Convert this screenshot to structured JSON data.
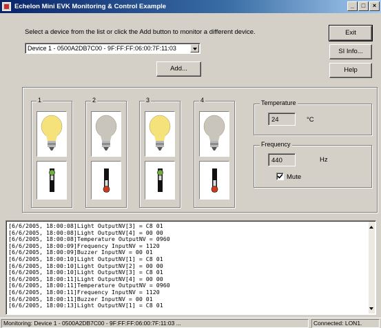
{
  "window": {
    "title": "Echelon Mini EVK Monitoring & Control Example",
    "controls": {
      "minimize": "_",
      "maximize": "□",
      "close": "×"
    }
  },
  "instructions": "Select a device from the list or click the Add button to monitor a different device.",
  "device_select": {
    "selected": "Device 1 - 0500A2DB7C00 - 9F:FF:FF:06:00:7F:11:03"
  },
  "buttons": {
    "exit": "Exit",
    "si_info": "SI Info...",
    "help": "Help",
    "add": "Add..."
  },
  "devices": [
    {
      "number": "1",
      "bulb": "bulb-on-icon",
      "switch": "switch-up-icon",
      "bulb_on": true
    },
    {
      "number": "2",
      "bulb": "bulb-off-icon",
      "switch": "switch-down-icon",
      "bulb_on": false
    },
    {
      "number": "3",
      "bulb": "bulb-on-icon",
      "switch": "switch-up-icon",
      "bulb_on": true
    },
    {
      "number": "4",
      "bulb": "bulb-off-icon",
      "switch": "switch-down-icon",
      "bulb_on": false
    }
  ],
  "temperature": {
    "label": "Temperature",
    "value": "24",
    "unit": "°C"
  },
  "frequency": {
    "label": "Frequency",
    "value": "440",
    "unit": "Hz"
  },
  "mute": {
    "label": "Mute",
    "checked": true
  },
  "log": [
    "[6/6/2005, 18:00:08]Light OutputNV[3] = C8 01",
    "[6/6/2005, 18:00:08]Light OutputNV[4] = 00 00",
    "[6/6/2005, 18:00:08]Temperature OutputNV = 0960",
    "[6/6/2005, 18:00:09]Frequency InputNV = 1120",
    "[6/6/2005, 18:00:09]Buzzer InputNV = 00 01",
    "[6/6/2005, 18:00:10]Light OutputNV[1] = C8 01",
    "[6/6/2005, 18:00:10]Light OutputNV[2] = 00 00",
    "[6/6/2005, 18:00:10]Light OutputNV[3] = C8 01",
    "[6/6/2005, 18:00:11]Light OutputNV[4] = 00 00",
    "[6/6/2005, 18:00:11]Temperature OutputNV = 0960",
    "[6/6/2005, 18:00:11]Frequency InputNV = 1120",
    "[6/6/2005, 18:00:11]Buzzer InputNV = 00 01",
    "[6/6/2005, 18:00:13]Light OutputNV[1] = C8 01"
  ],
  "status": {
    "monitoring": "Monitoring: Device 1 - 0500A2DB7C00 - 9F:FF:FF:06:00:7F:11:03 ...",
    "connection": "Connected: LON1."
  },
  "colors": {
    "bulb_on": "#f6e27a",
    "bulb_off": "#c9c4bc",
    "switch_on": "#6fae3a",
    "switch_off": "#d03a1a"
  }
}
